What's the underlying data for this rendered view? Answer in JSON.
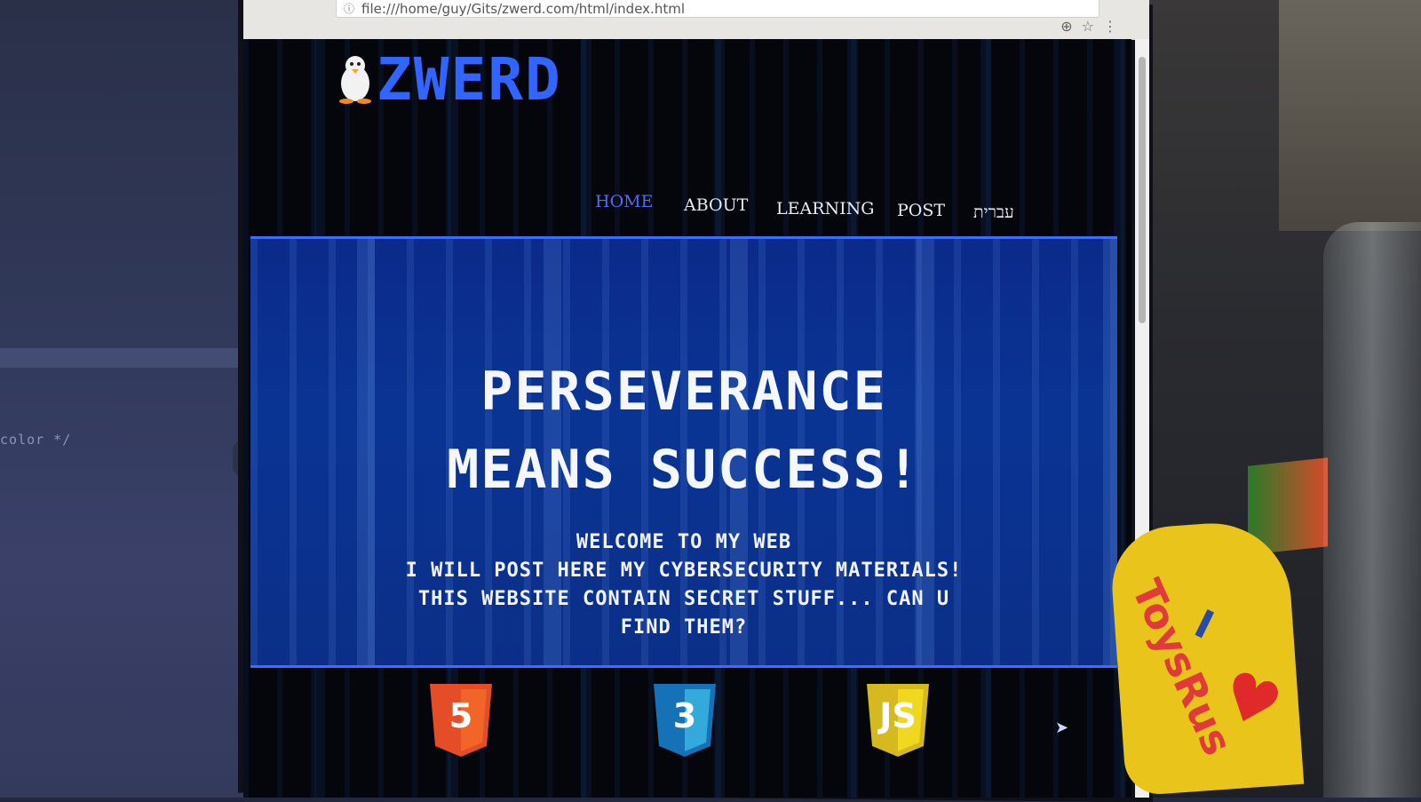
{
  "editor": {
    "code_text": "color */"
  },
  "browser": {
    "url": "file:///home/guy/Gits/zwerd.com/html/index.html"
  },
  "site": {
    "logo_text": "ZWERD",
    "nav": [
      {
        "label": "HOME",
        "active": true
      },
      {
        "label": "ABOUT",
        "active": false
      },
      {
        "label": "LEARNING",
        "active": false
      },
      {
        "label": "POST",
        "active": false
      },
      {
        "label": "עברית",
        "active": false
      }
    ],
    "headline_line1": "PERSEVERANCE",
    "headline_line2": "MEANS SUCCESS!",
    "intro_line1": "WELCOME TO MY WEB",
    "intro_line2": "I WILL POST HERE MY CYBERSECURITY MATERIALS!",
    "intro_line3": "THIS WEBSITE CONTAIN SECRET STUFF... CAN U",
    "intro_line4": "FIND THEM?",
    "badges": [
      {
        "label": "5",
        "name": "HTML5",
        "color": "#e44d26"
      },
      {
        "label": "3",
        "name": "CSS3",
        "color": "#1f8de0"
      },
      {
        "label": "JS",
        "name": "JS",
        "color": "#e8c82a"
      }
    ]
  },
  "toy": {
    "brand": "ToysRus",
    "love": "I"
  },
  "colors": {
    "accent": "#3b6bff",
    "logo": "#3264ff",
    "hero_bg": "#0a3494"
  }
}
